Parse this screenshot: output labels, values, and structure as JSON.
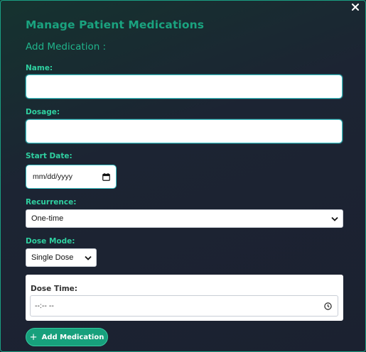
{
  "modal": {
    "close_label": "×",
    "title": "Manage Patient Medications",
    "subtitle": "Add Medication :"
  },
  "form": {
    "name_label": "Name:",
    "name_value": "",
    "dosage_label": "Dosage:",
    "dosage_value": "",
    "start_date_label": "Start Date:",
    "start_date_placeholder": "mm/dd/yyyy",
    "recurrence_label": "Recurrence:",
    "recurrence_selected": "One-time",
    "dose_mode_label": "Dose Mode:",
    "dose_mode_selected": "Single Dose",
    "dose_time_label": "Dose Time:",
    "dose_time_placeholder": "--:-- --",
    "add_button_icon": "+",
    "add_button_label": "Add Medication"
  },
  "colors": {
    "accent": "#1aa37f",
    "label": "#2fd0a0",
    "input_border": "#3bc2c6",
    "background": "#1c2433"
  },
  "icons": [
    "close-icon",
    "calendar-icon",
    "chevron-down-icon",
    "clock-icon",
    "plus-icon"
  ]
}
